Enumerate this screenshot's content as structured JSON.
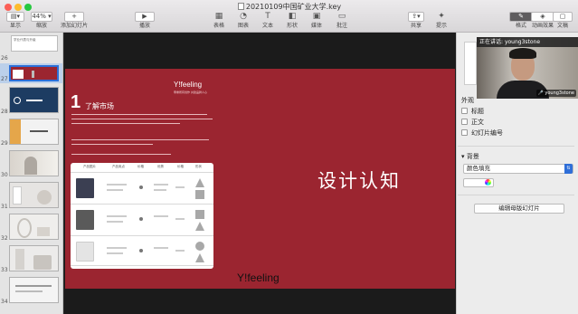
{
  "window": {
    "title": "20210109中国矿业大学.key"
  },
  "toolbar": {
    "view_label": "显示",
    "zoom_value": "44%",
    "zoom_label": "缩放",
    "add_slide_label": "添加幻灯片",
    "play_label": "播放",
    "table_label": "表格",
    "chart_label": "图表",
    "text_label": "文本",
    "shape_label": "形状",
    "media_label": "媒体",
    "comment_label": "批注",
    "share_label": "共享",
    "tips_label": "提示",
    "format_label": "格式",
    "animate_label": "动画效果",
    "document_label": "文稿"
  },
  "sidebar": {
    "top_label": "学业代表与升级",
    "slides": [
      {
        "num": "26"
      },
      {
        "num": "27"
      },
      {
        "num": "28"
      },
      {
        "num": "29"
      },
      {
        "num": "30"
      },
      {
        "num": "31"
      },
      {
        "num": "32"
      },
      {
        "num": "33"
      },
      {
        "num": "34"
      }
    ]
  },
  "slide": {
    "section_number": "1",
    "section_title": "了解市场",
    "brand": "Y!feeling",
    "brand_tagline": "尊重所有创作   共建品牌人心",
    "title_main": "设计认知",
    "brand_bottom": "Y!feeling",
    "table_headers": [
      "产品图片",
      "产品卖点",
      "价格",
      "优势",
      "价格",
      "形状"
    ]
  },
  "video": {
    "speaking_prefix": "正在讲话: ",
    "speaker": "young3stone",
    "name_tag": "young3stone"
  },
  "inspector": {
    "appearance_label": "外观",
    "title_label": "标题",
    "body_label": "正文",
    "slide_number_label": "幻灯片编号",
    "background_label": "背景",
    "fill_value": "颜色填充",
    "edit_master_label": "编辑母版幻灯片"
  },
  "colors": {
    "slide_bg": "#9b2530",
    "selection": "#2c70d8"
  }
}
